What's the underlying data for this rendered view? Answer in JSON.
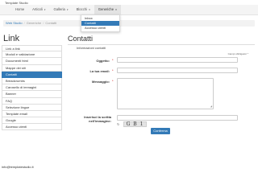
{
  "site": {
    "title": "Template Studio"
  },
  "nav": {
    "items": [
      {
        "label": "Home",
        "caret": ""
      },
      {
        "label": "Articoli",
        "caret": "▾"
      },
      {
        "label": "Galleria",
        "caret": "▾"
      },
      {
        "label": "Blocchi",
        "caret": "▾"
      },
      {
        "label": "Generiche",
        "caret": "▾"
      }
    ],
    "dropdown": [
      {
        "label": "Inbox"
      },
      {
        "label": "Contatti"
      },
      {
        "label": "Accesso utenti"
      }
    ]
  },
  "breadcrumb": {
    "home": "Web Studio",
    "section": "Generiche",
    "current": "Contatti",
    "separator": "/"
  },
  "sidebar": {
    "title": "Link",
    "items": [
      {
        "label": "Link a link"
      },
      {
        "label": "Moduli e validazione"
      },
      {
        "label": "Documenti html"
      },
      {
        "label": "Mappe dei siti"
      },
      {
        "label": "Contatti"
      },
      {
        "label": "Breadcrumbs"
      },
      {
        "label": "Carosello di immagini"
      },
      {
        "label": "Banner"
      },
      {
        "label": "FAQ"
      },
      {
        "label": "Selezione lingue"
      },
      {
        "label": "Template email"
      },
      {
        "label": "Google"
      },
      {
        "label": "Accesso utenti"
      }
    ]
  },
  "footer": {
    "email": "info@templatestudio.it"
  },
  "form": {
    "title": "Contatti",
    "subtitle": "Informazioni contatti",
    "required_note": "Campi obbligatori *",
    "required_mark": "*",
    "fields": {
      "subject_label": "Oggetto:",
      "email_label": "La tua email:",
      "message_label": "Messaggio:",
      "captcha_label_1": "Inserisci la scritta",
      "captcha_label_2": "nell'immagine:"
    },
    "captcha_text": "G B 1",
    "refresh_icon": "↻",
    "textarea_grip": "◢",
    "submit_label": "Conferma"
  },
  "colors": {
    "accent": "#337ab7",
    "required": "#cc0000"
  }
}
